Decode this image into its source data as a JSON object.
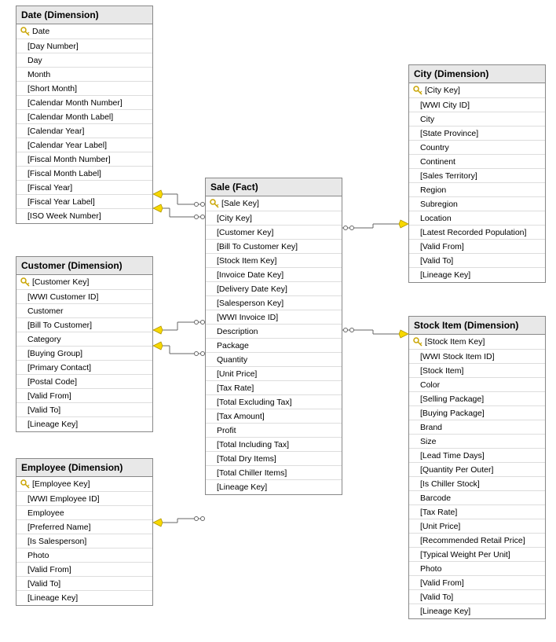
{
  "tables": {
    "date": {
      "title": "Date (Dimension)",
      "columns": [
        {
          "name": "Date",
          "key": true
        },
        {
          "name": "[Day Number]"
        },
        {
          "name": "Day"
        },
        {
          "name": "Month"
        },
        {
          "name": "[Short Month]"
        },
        {
          "name": "[Calendar Month Number]"
        },
        {
          "name": "[Calendar Month Label]"
        },
        {
          "name": "[Calendar Year]"
        },
        {
          "name": "[Calendar Year Label]"
        },
        {
          "name": "[Fiscal Month Number]"
        },
        {
          "name": "[Fiscal Month Label]"
        },
        {
          "name": "[Fiscal Year]"
        },
        {
          "name": "[Fiscal Year Label]"
        },
        {
          "name": "[ISO Week Number]"
        }
      ]
    },
    "customer": {
      "title": "Customer (Dimension)",
      "columns": [
        {
          "name": "[Customer Key]",
          "key": true
        },
        {
          "name": "[WWI Customer ID]"
        },
        {
          "name": "Customer"
        },
        {
          "name": "[Bill To Customer]"
        },
        {
          "name": "Category"
        },
        {
          "name": "[Buying Group]"
        },
        {
          "name": "[Primary Contact]"
        },
        {
          "name": "[Postal Code]"
        },
        {
          "name": "[Valid From]"
        },
        {
          "name": "[Valid To]"
        },
        {
          "name": "[Lineage Key]"
        }
      ]
    },
    "employee": {
      "title": "Employee (Dimension)",
      "columns": [
        {
          "name": "[Employee Key]",
          "key": true
        },
        {
          "name": "[WWI Employee ID]"
        },
        {
          "name": "Employee"
        },
        {
          "name": "[Preferred Name]"
        },
        {
          "name": "[Is Salesperson]"
        },
        {
          "name": "Photo"
        },
        {
          "name": "[Valid From]"
        },
        {
          "name": "[Valid To]"
        },
        {
          "name": "[Lineage Key]"
        }
      ]
    },
    "sale": {
      "title": "Sale (Fact)",
      "columns": [
        {
          "name": "[Sale Key]",
          "key": true
        },
        {
          "name": "[City Key]"
        },
        {
          "name": "[Customer Key]"
        },
        {
          "name": "[Bill To Customer Key]"
        },
        {
          "name": "[Stock Item Key]"
        },
        {
          "name": "[Invoice Date Key]"
        },
        {
          "name": "[Delivery Date Key]"
        },
        {
          "name": "[Salesperson Key]"
        },
        {
          "name": "[WWI Invoice ID]"
        },
        {
          "name": "Description"
        },
        {
          "name": "Package"
        },
        {
          "name": "Quantity"
        },
        {
          "name": "[Unit Price]"
        },
        {
          "name": "[Tax Rate]"
        },
        {
          "name": "[Total Excluding Tax]"
        },
        {
          "name": "[Tax Amount]"
        },
        {
          "name": "Profit"
        },
        {
          "name": "[Total Including Tax]"
        },
        {
          "name": "[Total Dry Items]"
        },
        {
          "name": "[Total Chiller Items]"
        },
        {
          "name": "[Lineage Key]"
        }
      ]
    },
    "city": {
      "title": "City (Dimension)",
      "columns": [
        {
          "name": "[City Key]",
          "key": true
        },
        {
          "name": "[WWI City ID]"
        },
        {
          "name": "City"
        },
        {
          "name": "[State Province]"
        },
        {
          "name": "Country"
        },
        {
          "name": "Continent"
        },
        {
          "name": "[Sales Territory]"
        },
        {
          "name": "Region"
        },
        {
          "name": "Subregion"
        },
        {
          "name": "Location"
        },
        {
          "name": "[Latest Recorded Population]"
        },
        {
          "name": "[Valid From]"
        },
        {
          "name": "[Valid To]"
        },
        {
          "name": "[Lineage Key]"
        }
      ]
    },
    "stockitem": {
      "title": "Stock Item (Dimension)",
      "columns": [
        {
          "name": "[Stock Item Key]",
          "key": true
        },
        {
          "name": "[WWI Stock Item ID]"
        },
        {
          "name": "[Stock Item]"
        },
        {
          "name": "Color"
        },
        {
          "name": "[Selling Package]"
        },
        {
          "name": "[Buying Package]"
        },
        {
          "name": "Brand"
        },
        {
          "name": "Size"
        },
        {
          "name": "[Lead Time Days]"
        },
        {
          "name": "[Quantity Per Outer]"
        },
        {
          "name": "[Is Chiller Stock]"
        },
        {
          "name": "Barcode"
        },
        {
          "name": "[Tax Rate]"
        },
        {
          "name": "[Unit Price]"
        },
        {
          "name": "[Recommended Retail Price]"
        },
        {
          "name": "[Typical Weight Per Unit]"
        },
        {
          "name": "Photo"
        },
        {
          "name": "[Valid From]"
        },
        {
          "name": "[Valid To]"
        },
        {
          "name": "[Lineage Key]"
        }
      ]
    }
  }
}
